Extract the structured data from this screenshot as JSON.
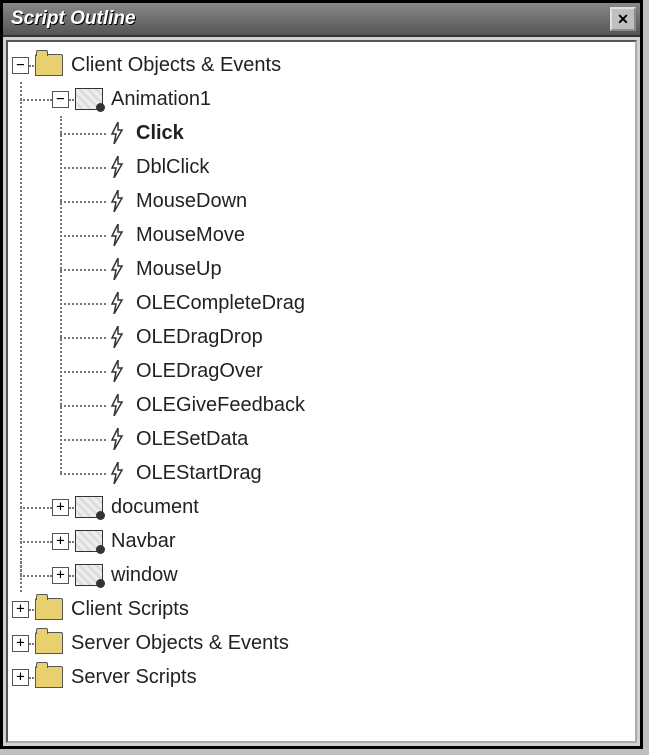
{
  "window": {
    "title": "Script Outline",
    "close_symbol": "✕"
  },
  "tree": {
    "root0": {
      "label": "Client Objects & Events",
      "expander": "−",
      "children": {
        "animation1": {
          "label": "Animation1",
          "expander": "−",
          "events": [
            {
              "label": "Click",
              "bold": true
            },
            {
              "label": "DblClick"
            },
            {
              "label": "MouseDown"
            },
            {
              "label": "MouseMove"
            },
            {
              "label": "MouseUp"
            },
            {
              "label": "OLECompleteDrag"
            },
            {
              "label": "OLEDragDrop"
            },
            {
              "label": "OLEDragOver"
            },
            {
              "label": "OLEGiveFeedback"
            },
            {
              "label": "OLESetData"
            },
            {
              "label": "OLEStartDrag"
            }
          ]
        },
        "document": {
          "label": "document",
          "expander": "+"
        },
        "navbar": {
          "label": "Navbar",
          "expander": "+"
        },
        "window_obj": {
          "label": "window",
          "expander": "+"
        }
      }
    },
    "root1": {
      "label": "Client Scripts",
      "expander": "+"
    },
    "root2": {
      "label": "Server Objects & Events",
      "expander": "+"
    },
    "root3": {
      "label": "Server Scripts",
      "expander": "+"
    }
  }
}
